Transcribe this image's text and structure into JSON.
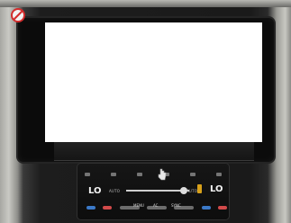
{
  "climate_panel": {
    "left_temperature": "LO",
    "right_temperature": "LO",
    "left_mode": "AUTO",
    "right_mode": "AUTO",
    "bottom_labels": [
      "MENU",
      "AC",
      "SYNC"
    ]
  },
  "icons": {
    "sticker": "no-sign-icon",
    "cursor": "pointer-hand-icon"
  },
  "colors": {
    "heat": "#d24a4a",
    "cool": "#3b79c8",
    "warning": "#d8a11a"
  }
}
